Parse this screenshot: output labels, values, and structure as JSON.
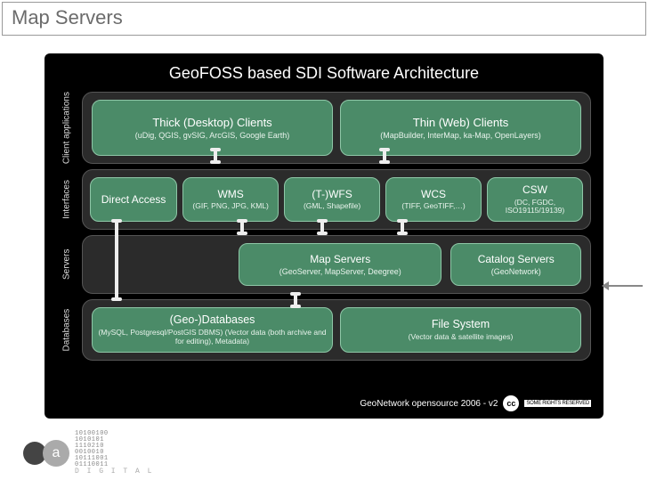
{
  "slide_title": "Map Servers",
  "diagram_title": "GeoFOSS based SDI Software Architecture",
  "rows": {
    "clients": {
      "label": "Client applications",
      "thick": {
        "title": "Thick (Desktop) Clients",
        "sub": "(uDig, QGIS, gvSIG, ArcGIS, Google Earth)"
      },
      "thin": {
        "title": "Thin (Web) Clients",
        "sub": "(MapBuilder, InterMap, ka-Map, OpenLayers)"
      }
    },
    "interfaces": {
      "label": "Interfaces",
      "direct": {
        "title": "Direct Access",
        "sub": ""
      },
      "wms": {
        "title": "WMS",
        "sub": "(GIF, PNG, JPG, KML)"
      },
      "wfs": {
        "title": "(T-)WFS",
        "sub": "(GML, Shapefile)"
      },
      "wcs": {
        "title": "WCS",
        "sub": "(TIFF, GeoTIFF,…)"
      },
      "csw": {
        "title": "CSW",
        "sub": "(DC, FGDC, ISO19115/19139)"
      }
    },
    "servers": {
      "label": "Servers",
      "map": {
        "title": "Map Servers",
        "sub": "(GeoServer, MapServer, Deegree)"
      },
      "catalog": {
        "title": "Catalog Servers",
        "sub": "(GeoNetwork)"
      }
    },
    "databases": {
      "label": "Databases",
      "geo": {
        "title": "(Geo-)Databases",
        "sub": "(MySQL, Postgresql/PostGIS DBMS) (Vector data (both archive and for editing), Metadata)"
      },
      "file": {
        "title": "File System",
        "sub": "(Vector data & satellite images)"
      }
    }
  },
  "attribution": "GeoNetwork opensource 2006 - v2",
  "cc_label": "cc",
  "rights_label": "SOME RIGHTS RESERVED",
  "logo": {
    "brand": "D I G I T A L",
    "bits": "10100100\n1010101\n1110210\n0010010\n10111001\n01110011"
  }
}
